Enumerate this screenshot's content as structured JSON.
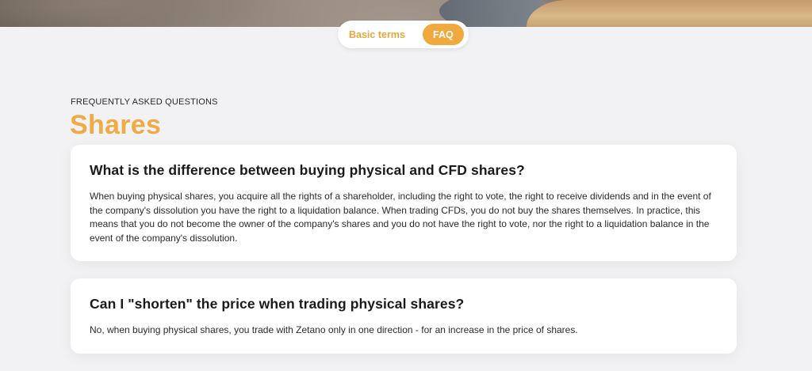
{
  "tabs": {
    "basic_terms": "Basic terms",
    "faq": "FAQ",
    "active": "FAQ"
  },
  "section": {
    "eyebrow": "FREQUENTLY ASKED QUESTIONS",
    "title": "Shares"
  },
  "faq_items": [
    {
      "question": "What is the difference between buying physical and CFD shares?",
      "answer": "When buying physical shares, you acquire all the rights of a shareholder, including the right to vote, the right to receive dividends and in the event of the company's dissolution you have the right to a liquidation balance. When trading CFDs, you do not buy the shares themselves. In practice, this means that you do not become the owner of the company's shares and you do not have the right to vote, nor the right to a liquidation balance in the event of the company's dissolution."
    },
    {
      "question": "Can I \"shorten\" the price when trading physical shares?",
      "answer": "No, when buying physical shares, you trade with Zetano only in one direction - for an increase in the price of shares."
    }
  ],
  "colors": {
    "accent": "#efa93f",
    "title": "#efab45",
    "background": "#f2f2f4",
    "card": "#ffffff"
  }
}
